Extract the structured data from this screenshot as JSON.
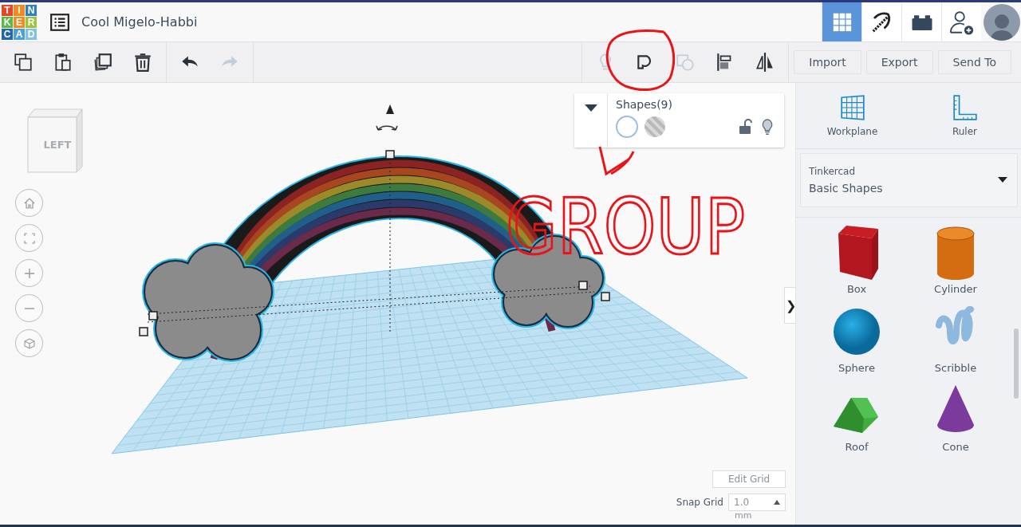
{
  "header": {
    "logo_letters": [
      "T",
      "I",
      "N",
      "K",
      "E",
      "R",
      "C",
      "A",
      "D"
    ],
    "project_title": "Cool Migelo-Habbi"
  },
  "header_views": [
    {
      "kind": "grid",
      "selected": true
    },
    {
      "kind": "pickaxe",
      "selected": false
    },
    {
      "kind": "bricks",
      "selected": false
    }
  ],
  "toolbar": {
    "actions": [
      {
        "kind": "copy",
        "disabled": false
      },
      {
        "kind": "paste",
        "disabled": false
      },
      {
        "kind": "duplicate",
        "disabled": false
      },
      {
        "kind": "delete",
        "disabled": false
      },
      {
        "kind": "undo",
        "disabled": false
      },
      {
        "kind": "redo",
        "disabled": true
      }
    ],
    "shape_actions": [
      {
        "kind": "show",
        "disabled": true
      },
      {
        "kind": "group",
        "disabled": false
      },
      {
        "kind": "ungroup",
        "disabled": true
      },
      {
        "kind": "align",
        "disabled": false
      },
      {
        "kind": "mirror",
        "disabled": false
      }
    ],
    "buttons": [
      "Import",
      "Export",
      "Send To"
    ]
  },
  "view_cube": {
    "face_label": "LEFT"
  },
  "nav_buttons": [
    {
      "kind": "home"
    },
    {
      "kind": "fit"
    },
    {
      "kind": "zoom_in"
    },
    {
      "kind": "zoom_out"
    },
    {
      "kind": "perspective"
    }
  ],
  "inspector": {
    "title": "Shapes(9)",
    "locked": false
  },
  "grid_controls": {
    "edit_button": "Edit Grid",
    "snap_label": "Snap Grid",
    "snap_value": "1.0",
    "snap_unit": "mm"
  },
  "panel_handle": "❯",
  "panel": {
    "tools": [
      {
        "kind": "workplane",
        "label": "Workplane"
      },
      {
        "kind": "ruler",
        "label": "Ruler"
      }
    ],
    "library": {
      "source": "Tinkercad",
      "category": "Basic Shapes"
    },
    "shapes": [
      {
        "kind": "box",
        "label": "Box"
      },
      {
        "kind": "cylinder",
        "label": "Cylinder"
      },
      {
        "kind": "sphere",
        "label": "Sphere"
      },
      {
        "kind": "scribble",
        "label": "Scribble"
      },
      {
        "kind": "roof",
        "label": "Roof"
      },
      {
        "kind": "cone",
        "label": "Cone"
      }
    ]
  },
  "annotation": {
    "text": "GROUP"
  }
}
